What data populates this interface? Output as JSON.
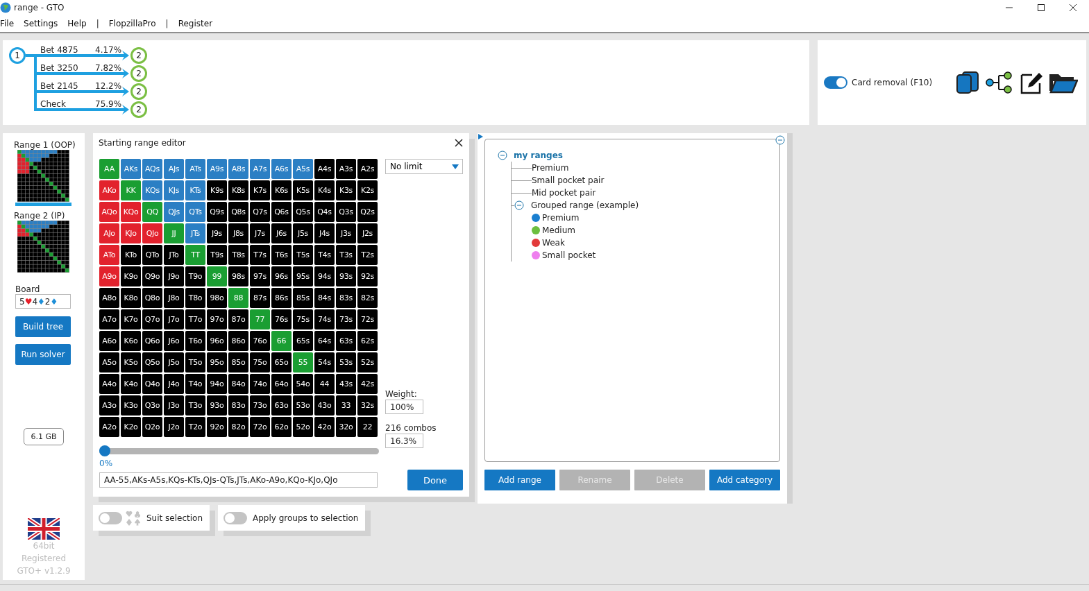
{
  "window": {
    "title": "range - GTO"
  },
  "menu": [
    {
      "label": "File",
      "kind": "item"
    },
    {
      "label": "Settings",
      "kind": "item"
    },
    {
      "label": "Help",
      "kind": "item"
    },
    {
      "label": "|",
      "kind": "separator"
    },
    {
      "label": "FlopzillaPro",
      "kind": "item"
    },
    {
      "label": "|",
      "kind": "separator"
    },
    {
      "label": "Register",
      "kind": "item"
    }
  ],
  "decision_tree": {
    "root": "1",
    "branches": [
      {
        "action": "Bet 4875",
        "frequency": "4.17%",
        "node": "2"
      },
      {
        "action": "Bet 3250",
        "frequency": "7.82%",
        "node": "2"
      },
      {
        "action": "Bet 2145",
        "frequency": "12.2%",
        "node": "2"
      },
      {
        "action": "Check",
        "frequency": "75.9%",
        "node": "2"
      }
    ]
  },
  "card_removal": {
    "label": "Card removal (F10)",
    "on": true
  },
  "sidebar": {
    "ranges": [
      {
        "label": "Range 1 (OOP)",
        "selected": true
      },
      {
        "label": "Range 2 (IP)",
        "selected": false
      }
    ],
    "board_label": "Board",
    "board": [
      {
        "rank": "5",
        "suit": "♥",
        "color": "#e8202a"
      },
      {
        "rank": "4",
        "suit": "♦",
        "color": "#1e8fd8"
      },
      {
        "rank": "2",
        "suit": "♦",
        "color": "#1e8fd8"
      }
    ],
    "buttons": [
      "Build tree",
      "Run solver"
    ],
    "memory": "6.1 GB",
    "footer": [
      "64bit",
      "Registered",
      "GTO+ v1.2.9"
    ]
  },
  "range_editor": {
    "title": "Starting range editor",
    "grid": [
      [
        {
          "label": "AA",
          "color": "#1a9e32"
        },
        {
          "label": "AKs",
          "color": "#2b7fc4"
        },
        {
          "label": "AQs",
          "color": "#2b7fc4"
        },
        {
          "label": "AJs",
          "color": "#2b7fc4"
        },
        {
          "label": "ATs",
          "color": "#2b7fc4"
        },
        {
          "label": "A9s",
          "color": "#2b7fc4"
        },
        {
          "label": "A8s",
          "color": "#2b7fc4"
        },
        {
          "label": "A7s",
          "color": "#2b7fc4"
        },
        {
          "label": "A6s",
          "color": "#2b7fc4"
        },
        {
          "label": "A5s",
          "color": "#2b7fc4"
        },
        {
          "label": "A4s",
          "color": "#000000"
        },
        {
          "label": "A3s",
          "color": "#000000"
        },
        {
          "label": "A2s",
          "color": "#000000"
        }
      ],
      [
        {
          "label": "AKo",
          "color": "#e2222d"
        },
        {
          "label": "KK",
          "color": "#1a9e32"
        },
        {
          "label": "KQs",
          "color": "#2b7fc4"
        },
        {
          "label": "KJs",
          "color": "#2b7fc4"
        },
        {
          "label": "KTs",
          "color": "#2b7fc4"
        },
        {
          "label": "K9s",
          "color": "#000000"
        },
        {
          "label": "K8s",
          "color": "#000000"
        },
        {
          "label": "K7s",
          "color": "#000000"
        },
        {
          "label": "K6s",
          "color": "#000000"
        },
        {
          "label": "K5s",
          "color": "#000000"
        },
        {
          "label": "K4s",
          "color": "#000000"
        },
        {
          "label": "K3s",
          "color": "#000000"
        },
        {
          "label": "K2s",
          "color": "#000000"
        }
      ],
      [
        {
          "label": "AQo",
          "color": "#e2222d"
        },
        {
          "label": "KQo",
          "color": "#e2222d"
        },
        {
          "label": "QQ",
          "color": "#1a9e32"
        },
        {
          "label": "QJs",
          "color": "#2b7fc4"
        },
        {
          "label": "QTs",
          "color": "#2b7fc4"
        },
        {
          "label": "Q9s",
          "color": "#000000"
        },
        {
          "label": "Q8s",
          "color": "#000000"
        },
        {
          "label": "Q7s",
          "color": "#000000"
        },
        {
          "label": "Q6s",
          "color": "#000000"
        },
        {
          "label": "Q5s",
          "color": "#000000"
        },
        {
          "label": "Q4s",
          "color": "#000000"
        },
        {
          "label": "Q3s",
          "color": "#000000"
        },
        {
          "label": "Q2s",
          "color": "#000000"
        }
      ],
      [
        {
          "label": "AJo",
          "color": "#e2222d"
        },
        {
          "label": "KJo",
          "color": "#e2222d"
        },
        {
          "label": "QJo",
          "color": "#e2222d"
        },
        {
          "label": "JJ",
          "color": "#1a9e32"
        },
        {
          "label": "JTs",
          "color": "#2b7fc4"
        },
        {
          "label": "J9s",
          "color": "#000000"
        },
        {
          "label": "J8s",
          "color": "#000000"
        },
        {
          "label": "J7s",
          "color": "#000000"
        },
        {
          "label": "J6s",
          "color": "#000000"
        },
        {
          "label": "J5s",
          "color": "#000000"
        },
        {
          "label": "J4s",
          "color": "#000000"
        },
        {
          "label": "J3s",
          "color": "#000000"
        },
        {
          "label": "J2s",
          "color": "#000000"
        }
      ],
      [
        {
          "label": "ATo",
          "color": "#e2222d"
        },
        {
          "label": "KTo",
          "color": "#000000"
        },
        {
          "label": "QTo",
          "color": "#000000"
        },
        {
          "label": "JTo",
          "color": "#000000"
        },
        {
          "label": "TT",
          "color": "#1a9e32"
        },
        {
          "label": "T9s",
          "color": "#000000"
        },
        {
          "label": "T8s",
          "color": "#000000"
        },
        {
          "label": "T7s",
          "color": "#000000"
        },
        {
          "label": "T6s",
          "color": "#000000"
        },
        {
          "label": "T5s",
          "color": "#000000"
        },
        {
          "label": "T4s",
          "color": "#000000"
        },
        {
          "label": "T3s",
          "color": "#000000"
        },
        {
          "label": "T2s",
          "color": "#000000"
        }
      ],
      [
        {
          "label": "A9o",
          "color": "#e2222d"
        },
        {
          "label": "K9o",
          "color": "#000000"
        },
        {
          "label": "Q9o",
          "color": "#000000"
        },
        {
          "label": "J9o",
          "color": "#000000"
        },
        {
          "label": "T9o",
          "color": "#000000"
        },
        {
          "label": "99",
          "color": "#1a9e32"
        },
        {
          "label": "98s",
          "color": "#000000"
        },
        {
          "label": "97s",
          "color": "#000000"
        },
        {
          "label": "96s",
          "color": "#000000"
        },
        {
          "label": "95s",
          "color": "#000000"
        },
        {
          "label": "94s",
          "color": "#000000"
        },
        {
          "label": "93s",
          "color": "#000000"
        },
        {
          "label": "92s",
          "color": "#000000"
        }
      ],
      [
        {
          "label": "A8o",
          "color": "#000000"
        },
        {
          "label": "K8o",
          "color": "#000000"
        },
        {
          "label": "Q8o",
          "color": "#000000"
        },
        {
          "label": "J8o",
          "color": "#000000"
        },
        {
          "label": "T8o",
          "color": "#000000"
        },
        {
          "label": "98o",
          "color": "#000000"
        },
        {
          "label": "88",
          "color": "#1a9e32"
        },
        {
          "label": "87s",
          "color": "#000000"
        },
        {
          "label": "86s",
          "color": "#000000"
        },
        {
          "label": "85s",
          "color": "#000000"
        },
        {
          "label": "84s",
          "color": "#000000"
        },
        {
          "label": "83s",
          "color": "#000000"
        },
        {
          "label": "82s",
          "color": "#000000"
        }
      ],
      [
        {
          "label": "A7o",
          "color": "#000000"
        },
        {
          "label": "K7o",
          "color": "#000000"
        },
        {
          "label": "Q7o",
          "color": "#000000"
        },
        {
          "label": "J7o",
          "color": "#000000"
        },
        {
          "label": "T7o",
          "color": "#000000"
        },
        {
          "label": "97o",
          "color": "#000000"
        },
        {
          "label": "87o",
          "color": "#000000"
        },
        {
          "label": "77",
          "color": "#1a9e32"
        },
        {
          "label": "76s",
          "color": "#000000"
        },
        {
          "label": "75s",
          "color": "#000000"
        },
        {
          "label": "74s",
          "color": "#000000"
        },
        {
          "label": "73s",
          "color": "#000000"
        },
        {
          "label": "72s",
          "color": "#000000"
        }
      ],
      [
        {
          "label": "A6o",
          "color": "#000000"
        },
        {
          "label": "K6o",
          "color": "#000000"
        },
        {
          "label": "Q6o",
          "color": "#000000"
        },
        {
          "label": "J6o",
          "color": "#000000"
        },
        {
          "label": "T6o",
          "color": "#000000"
        },
        {
          "label": "96o",
          "color": "#000000"
        },
        {
          "label": "86o",
          "color": "#000000"
        },
        {
          "label": "76o",
          "color": "#000000"
        },
        {
          "label": "66",
          "color": "#1a9e32"
        },
        {
          "label": "65s",
          "color": "#000000"
        },
        {
          "label": "64s",
          "color": "#000000"
        },
        {
          "label": "63s",
          "color": "#000000"
        },
        {
          "label": "62s",
          "color": "#000000"
        }
      ],
      [
        {
          "label": "A5o",
          "color": "#000000"
        },
        {
          "label": "K5o",
          "color": "#000000"
        },
        {
          "label": "Q5o",
          "color": "#000000"
        },
        {
          "label": "J5o",
          "color": "#000000"
        },
        {
          "label": "T5o",
          "color": "#000000"
        },
        {
          "label": "95o",
          "color": "#000000"
        },
        {
          "label": "85o",
          "color": "#000000"
        },
        {
          "label": "75o",
          "color": "#000000"
        },
        {
          "label": "65o",
          "color": "#000000"
        },
        {
          "label": "55",
          "color": "#1a9e32"
        },
        {
          "label": "54s",
          "color": "#000000"
        },
        {
          "label": "53s",
          "color": "#000000"
        },
        {
          "label": "52s",
          "color": "#000000"
        }
      ],
      [
        {
          "label": "A4o",
          "color": "#000000"
        },
        {
          "label": "K4o",
          "color": "#000000"
        },
        {
          "label": "Q4o",
          "color": "#000000"
        },
        {
          "label": "J4o",
          "color": "#000000"
        },
        {
          "label": "T4o",
          "color": "#000000"
        },
        {
          "label": "94o",
          "color": "#000000"
        },
        {
          "label": "84o",
          "color": "#000000"
        },
        {
          "label": "74o",
          "color": "#000000"
        },
        {
          "label": "64o",
          "color": "#000000"
        },
        {
          "label": "54o",
          "color": "#000000"
        },
        {
          "label": "44",
          "color": "#000000"
        },
        {
          "label": "43s",
          "color": "#000000"
        },
        {
          "label": "42s",
          "color": "#000000"
        }
      ],
      [
        {
          "label": "A3o",
          "color": "#000000"
        },
        {
          "label": "K3o",
          "color": "#000000"
        },
        {
          "label": "Q3o",
          "color": "#000000"
        },
        {
          "label": "J3o",
          "color": "#000000"
        },
        {
          "label": "T3o",
          "color": "#000000"
        },
        {
          "label": "93o",
          "color": "#000000"
        },
        {
          "label": "83o",
          "color": "#000000"
        },
        {
          "label": "73o",
          "color": "#000000"
        },
        {
          "label": "63o",
          "color": "#000000"
        },
        {
          "label": "53o",
          "color": "#000000"
        },
        {
          "label": "43o",
          "color": "#000000"
        },
        {
          "label": "33",
          "color": "#000000"
        },
        {
          "label": "32s",
          "color": "#000000"
        }
      ],
      [
        {
          "label": "A2o",
          "color": "#000000"
        },
        {
          "label": "K2o",
          "color": "#000000"
        },
        {
          "label": "Q2o",
          "color": "#000000"
        },
        {
          "label": "J2o",
          "color": "#000000"
        },
        {
          "label": "T2o",
          "color": "#000000"
        },
        {
          "label": "92o",
          "color": "#000000"
        },
        {
          "label": "82o",
          "color": "#000000"
        },
        {
          "label": "72o",
          "color": "#000000"
        },
        {
          "label": "62o",
          "color": "#000000"
        },
        {
          "label": "52o",
          "color": "#000000"
        },
        {
          "label": "42o",
          "color": "#000000"
        },
        {
          "label": "32o",
          "color": "#000000"
        },
        {
          "label": "22",
          "color": "#000000"
        }
      ]
    ],
    "limit": "No limit",
    "weight_label": "Weight:",
    "weight": "100%",
    "combos_label": "216 combos",
    "combos_percent": "16.3%",
    "slider": {
      "level": 0,
      "reading": "0%"
    },
    "range_text": "AA-55,AKs-A5s,KQs-KTs,QJs-QTs,JTs,AKo-A9o,KQo-KJo,QJo",
    "done": "Done"
  },
  "range_manager": {
    "tree": [
      {
        "label": "my ranges",
        "expanded": true,
        "children": [
          {
            "label": "Premium"
          },
          {
            "label": "Small pocket pair"
          },
          {
            "label": "Mid pocket pair"
          },
          {
            "label": "Grouped range (example)",
            "expanded": true,
            "children": [
              {
                "label": "Premium",
                "color": "#1a7fd0"
              },
              {
                "label": "Medium",
                "color": "#6cbf3f"
              },
              {
                "label": "Weak",
                "color": "#e23a3a"
              },
              {
                "label": "Small pocket",
                "color": "#ee7fee"
              }
            ]
          }
        ]
      }
    ],
    "buttons": [
      {
        "label": "Add range",
        "disabled": false
      },
      {
        "label": "Rename",
        "disabled": true
      },
      {
        "label": "Delete",
        "disabled": true
      },
      {
        "label": "Add category",
        "disabled": false
      }
    ]
  },
  "options": [
    {
      "label": "Suit selection",
      "on": false,
      "kind": "suits"
    },
    {
      "label": "Apply groups to selection",
      "on": false,
      "kind": "plain"
    }
  ]
}
